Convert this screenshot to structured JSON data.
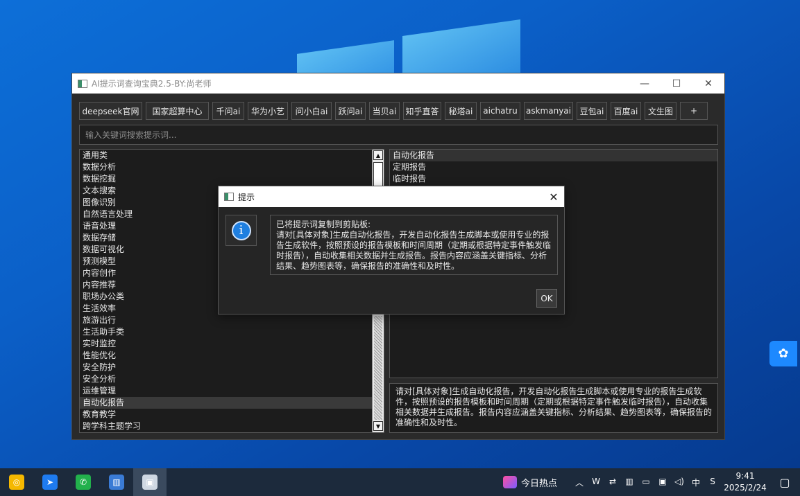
{
  "window": {
    "title": "AI提示词查询宝典2.5-BY:尚老师",
    "min_symbol": "—",
    "max_symbol": "☐",
    "close_symbol": "✕"
  },
  "toolbar": {
    "buttons": [
      "deepseek官网",
      "国家超算中心",
      "千问ai",
      "华为小艺",
      "问小白ai",
      "跃问ai",
      "当贝ai",
      "知乎直答",
      "秘塔ai",
      "aichatru",
      "askmanyai",
      "豆包ai",
      "百度ai",
      "文生图",
      "+"
    ]
  },
  "search": {
    "placeholder": "输入关键词搜索提示词..."
  },
  "categories": {
    "items": [
      "通用类",
      "数据分析",
      "数据挖掘",
      "文本搜索",
      "图像识别",
      "自然语言处理",
      "语音处理",
      "数据存储",
      "数据可视化",
      "预测模型",
      "内容创作",
      "内容推荐",
      "职场办公类",
      "生活效率",
      "旅游出行",
      "生活助手类",
      "实时监控",
      "性能优化",
      "安全防护",
      "安全分析",
      "运维管理",
      "自动化报告",
      "教育教学",
      "跨学科主题学习"
    ],
    "selected": "自动化报告"
  },
  "subitems": {
    "items": [
      "自动化报告",
      "定期报告",
      "临时报告"
    ],
    "selected": "自动化报告"
  },
  "detail": {
    "text": "请对[具体对象]生成自动化报告，开发自动化报告生成脚本或使用专业的报告生成软件，按照预设的报告模板和时间周期（定期或根据特定事件触发临时报告），自动收集相关数据并生成报告。报告内容应涵盖关键指标、分析结果、趋势图表等，确保报告的准确性和及时性。"
  },
  "dialog": {
    "title": "提示",
    "close_symbol": "✕",
    "icon_glyph": "i",
    "heading": "已将提示词复制到剪贴板:",
    "message": "请对[具体对象]生成自动化报告，开发自动化报告生成脚本或使用专业的报告生成软件，按照预设的报告模板和时间周期（定期或根据特定事件触发临时报告），自动收集相关数据并生成报告。报告内容应涵盖关键指标、分析结果、趋势图表等，确保报告的准确性和及时性。",
    "ok_label": "OK"
  },
  "taskbar": {
    "apps": [
      {
        "name": "app-orange",
        "color": "#f5b800",
        "glyph": "◎"
      },
      {
        "name": "app-feishu",
        "color": "#1e7bf0",
        "glyph": "➤"
      },
      {
        "name": "app-wechat",
        "color": "#22b14c",
        "glyph": "✆"
      },
      {
        "name": "app-files",
        "color": "#3a7bd5",
        "glyph": "▥"
      },
      {
        "name": "app-prompt-tool",
        "color": "#cfd8e3",
        "glyph": "▣"
      }
    ],
    "hot_label": "今日热点",
    "tray_symbols": [
      "︿",
      "W",
      "⇄",
      "▥",
      "▭",
      "▣",
      "◁)",
      "中",
      "S"
    ],
    "time": "9:41",
    "date": "2025/2/24",
    "notification_symbol": "▢"
  },
  "side_widget": {
    "glyph": "✿"
  }
}
